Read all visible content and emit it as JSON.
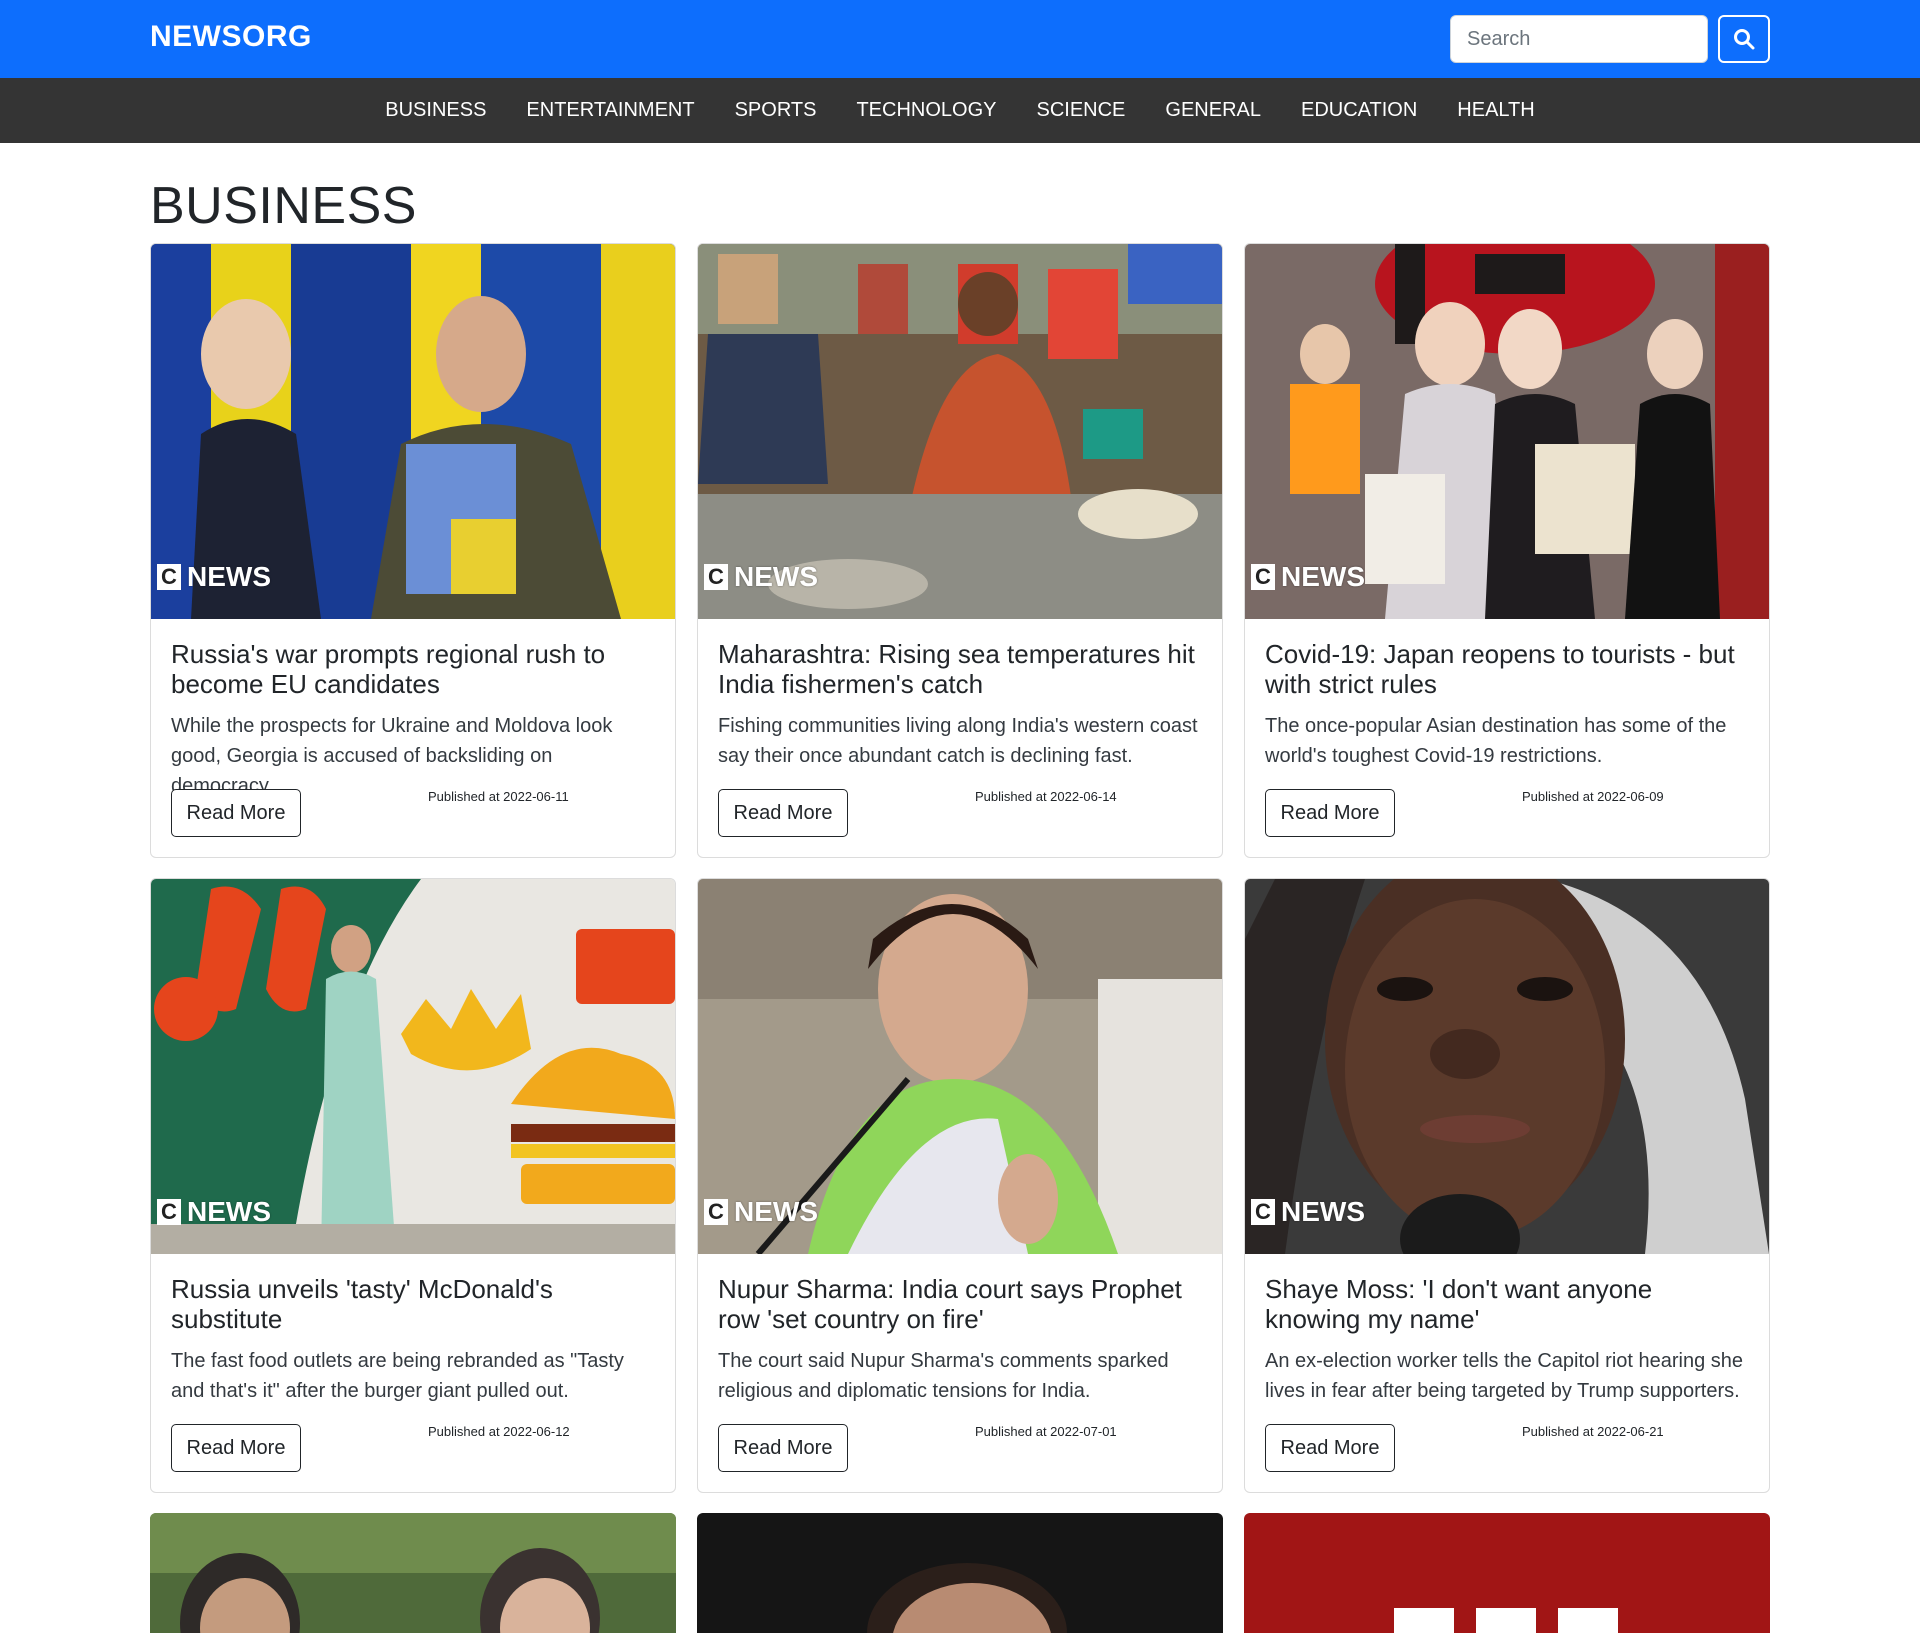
{
  "header": {
    "brand": "NEWSORG",
    "search_placeholder": "Search",
    "search_icon": "search-icon"
  },
  "nav": {
    "items": [
      "BUSINESS",
      "ENTERTAINMENT",
      "SPORTS",
      "TECHNOLOGY",
      "SCIENCE",
      "GENERAL",
      "EDUCATION",
      "HEALTH"
    ]
  },
  "main": {
    "title": "BUSINESS",
    "logo_letter": "C",
    "logo_text": "NEWS",
    "read_more_label": "Read More",
    "articles": [
      {
        "title": "Russia's war prompts regional rush to become EU candidates",
        "description": "While the prospects for Ukraine and Moldova look good, Georgia is accused of backsliding on democracy.",
        "published": "Published at 2022-06-11"
      },
      {
        "title": "Maharashtra: Rising sea temperatures hit India fishermen's catch",
        "description": "Fishing communities living along India's western coast say their once abundant catch is declining fast.",
        "published": "Published at 2022-06-14"
      },
      {
        "title": "Covid-19: Japan reopens to tourists - but with strict rules",
        "description": "The once-popular Asian destination has some of the world's toughest Covid-19 restrictions.",
        "published": "Published at 2022-06-09"
      },
      {
        "title": "Russia unveils 'tasty' McDonald's substitute",
        "description": "The fast food outlets are being rebranded as \"Tasty and that's it\" after the burger giant pulled out.",
        "published": "Published at 2022-06-12"
      },
      {
        "title": "Nupur Sharma: India court says Prophet row 'set country on fire'",
        "description": "The court said Nupur Sharma's comments sparked religious and diplomatic tensions for India.",
        "published": "Published at 2022-07-01"
      },
      {
        "title": "Shaye Moss: 'I don't want anyone knowing my name'",
        "description": "An ex-election worker tells the Capitol riot hearing she lives in fear after being targeted by Trump supporters.",
        "published": "Published at 2022-06-21"
      }
    ]
  }
}
